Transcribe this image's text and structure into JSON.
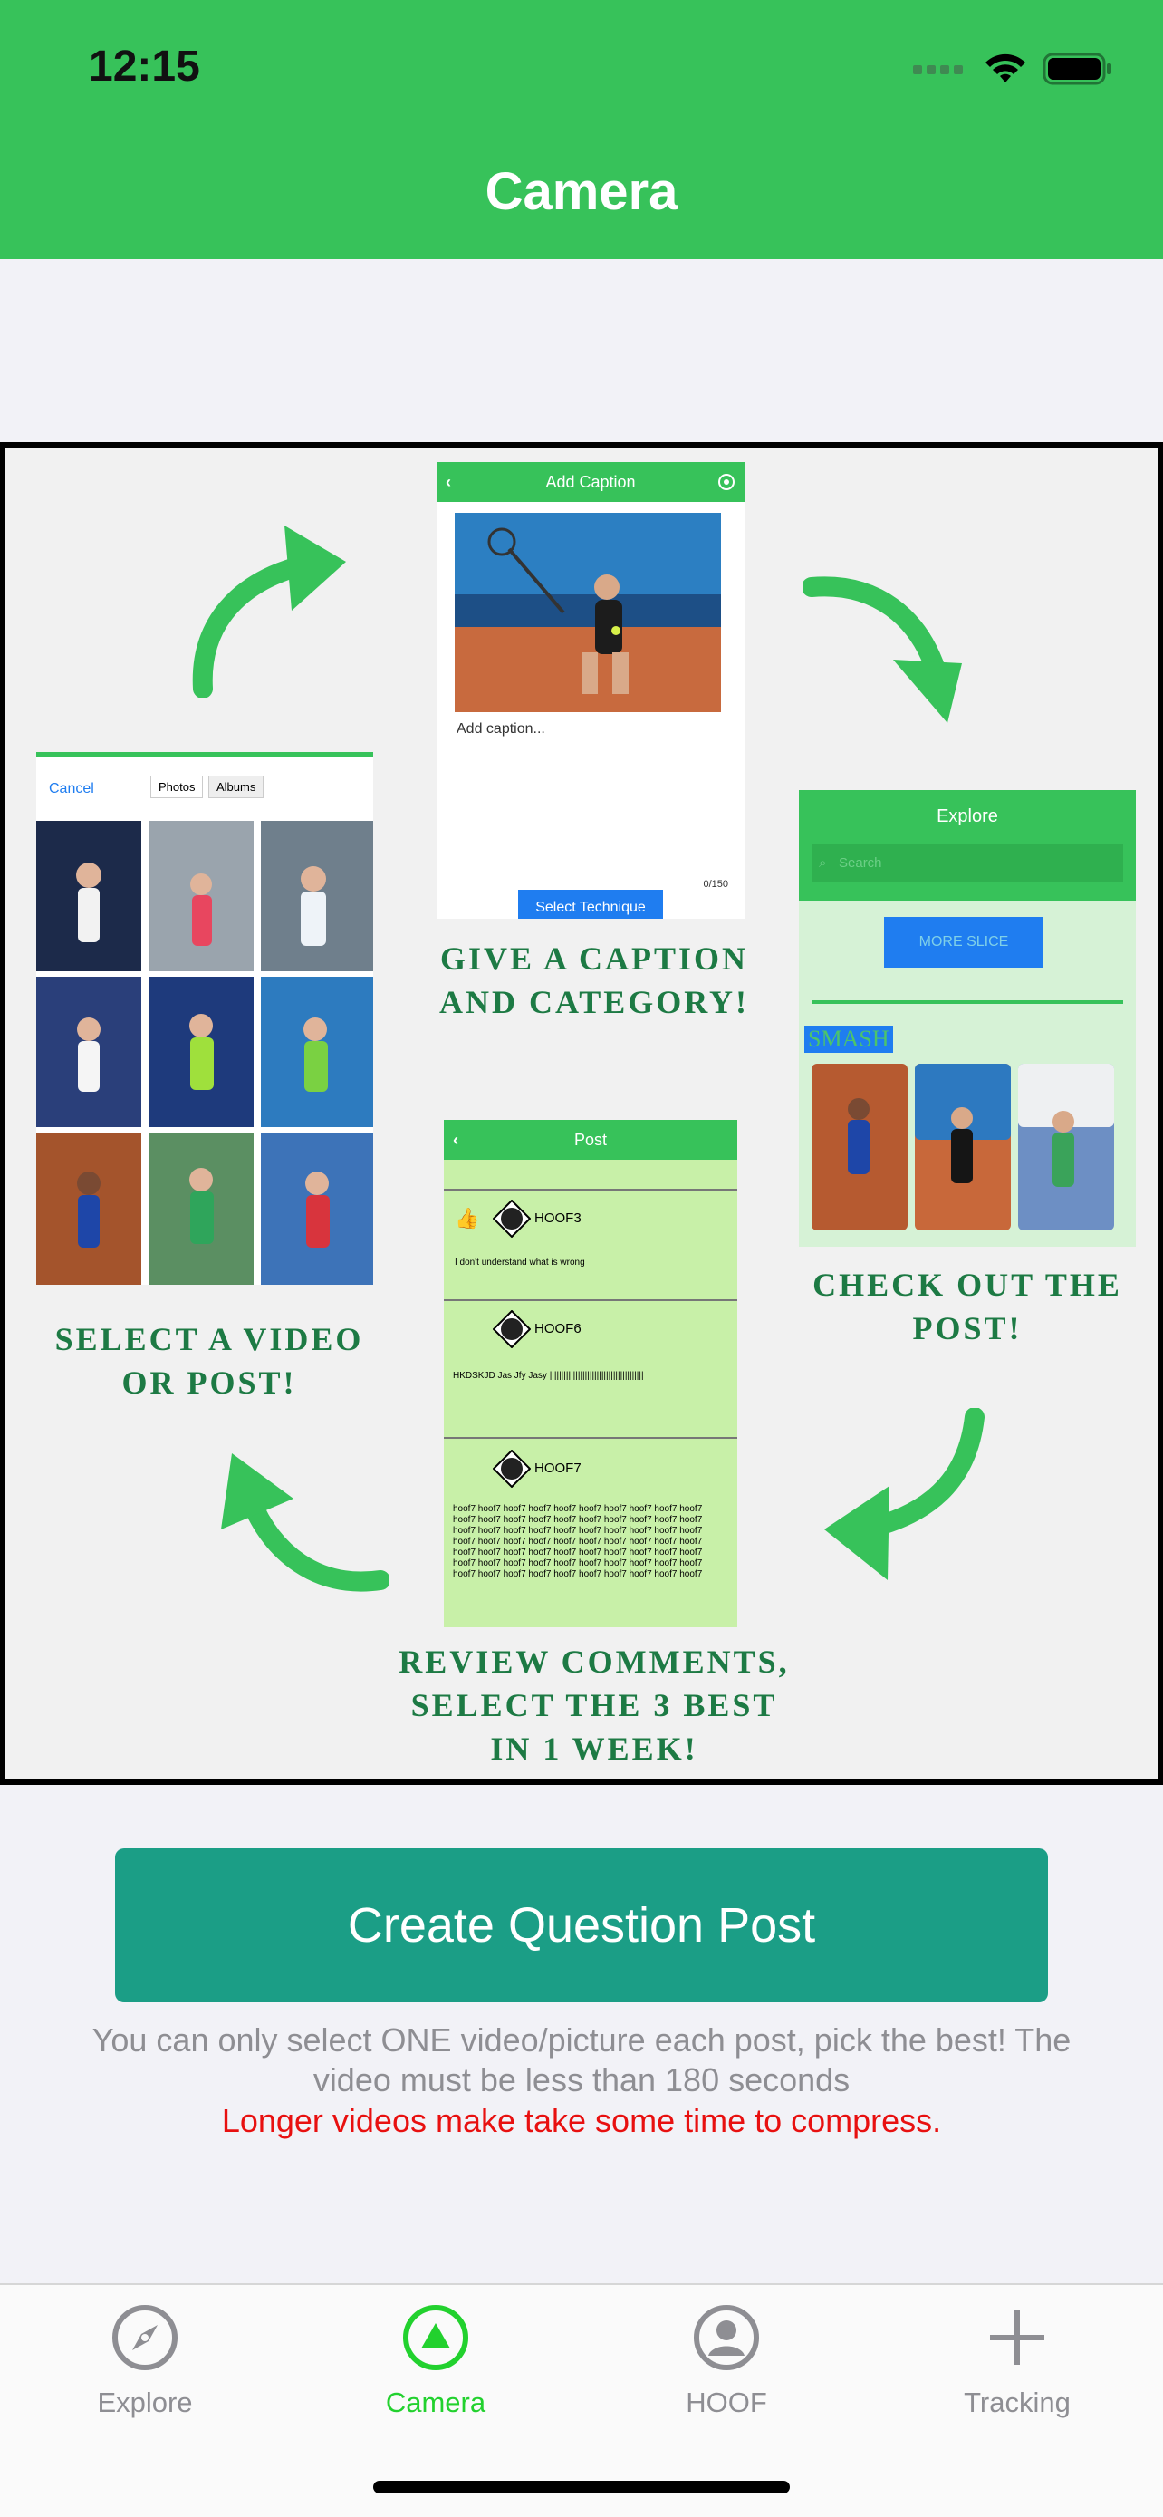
{
  "status_bar": {
    "time": "12:15"
  },
  "header": {
    "title": "Camera"
  },
  "infographic": {
    "caption_step": {
      "bar_title": "Add Caption",
      "placeholder": "Add caption...",
      "count": "0/150",
      "button": "Select Technique",
      "label_line1": "GIVE A CAPTION",
      "label_line2": "AND CATEGORY!"
    },
    "picker_step": {
      "cancel": "Cancel",
      "segment_photos": "Photos",
      "segment_albums": "Albums",
      "label_line1": "SELECT A VIDEO",
      "label_line2": "OR POST!"
    },
    "explore_step": {
      "bar_title": "Explore",
      "search": "Search",
      "button": "MORE SLICE",
      "tag": "SMASH",
      "label_line1": "CHECK OUT THE",
      "label_line2": "POST!"
    },
    "review_step": {
      "bar_title": "Post",
      "comments": [
        {
          "user": "HOOF3",
          "text": "I don't understand what is wrong"
        },
        {
          "user": "HOOF6",
          "text": "HKDSKJD Jas Jfy Jasy ||||||||||||||||||||||||||||||||||||||||"
        },
        {
          "user": "HOOF7",
          "text": "hoof7 hoof7 hoof7 hoof7 hoof7 hoof7 hoof7 hoof7 hoof7 hoof7 hoof7 hoof7 hoof7 hoof7 hoof7 hoof7 hoof7 hoof7 hoof7 hoof7 hoof7 hoof7 hoof7 hoof7 hoof7 hoof7 hoof7 hoof7 hoof7 hoof7 hoof7 hoof7 hoof7 hoof7 hoof7 hoof7 hoof7 hoof7 hoof7 hoof7 hoof7 hoof7 hoof7 hoof7 hoof7 hoof7 hoof7 hoof7 hoof7 hoof7 hoof7 hoof7 hoof7 hoof7 hoof7 hoof7 hoof7 hoof7 hoof7 hoof7 hoof7 hoof7 hoof7 hoof7 hoof7 hoof7 hoof7 hoof7 hoof7 hoof7"
        }
      ],
      "label_line1": "REVIEW COMMENTS,",
      "label_line2": "SELECT THE 3 BEST",
      "label_line3": "IN 1 WEEK!"
    }
  },
  "create_button": {
    "label": "Create Question Post"
  },
  "note": {
    "text": "You can only select ONE video/picture each post, pick the best! The video must be less than 180 seconds",
    "warning": "Longer videos make take some time to compress."
  },
  "tabbar": {
    "tabs": [
      {
        "label": "Explore",
        "icon": "compass-icon"
      },
      {
        "label": "Camera",
        "icon": "camera-triangle-icon",
        "active": true
      },
      {
        "label": "HOOF",
        "icon": "person-circle-icon"
      },
      {
        "label": "Tracking",
        "icon": "plus-icon"
      }
    ]
  },
  "colors": {
    "brand_green": "#37c25a",
    "button_teal": "#1b9e86",
    "active_tab": "#22d12e",
    "warning_red": "#e81010",
    "caption_green": "#1d7a44"
  }
}
